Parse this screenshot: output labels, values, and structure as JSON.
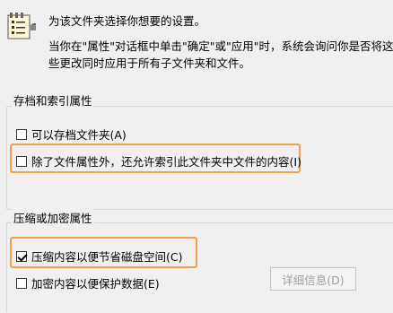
{
  "header": {
    "line1": "为该文件夹选择你想要的设置。",
    "line2": "当你在\"属性\"对话框中单击\"确定\"或\"应用\"时，系统会询问你是否将这",
    "line3": "些更改同时应用于所有子文件夹和文件。"
  },
  "archive_group": {
    "title": "存档和索引属性",
    "options": [
      {
        "label": "可以存档文件夹(A)",
        "checked": false
      },
      {
        "label": "除了文件属性外，还允许索引此文件夹中文件的内容(I)",
        "checked": false
      }
    ]
  },
  "compress_group": {
    "title": "压缩或加密属性",
    "options": [
      {
        "label": "压缩内容以便节省磁盘空间(C)",
        "checked": true
      },
      {
        "label": "加密内容以便保护数据(E)",
        "checked": false
      }
    ],
    "details_button": "详细信息(D)"
  },
  "colors": {
    "highlight": "#f0a050",
    "background": "#f0f0f0"
  }
}
